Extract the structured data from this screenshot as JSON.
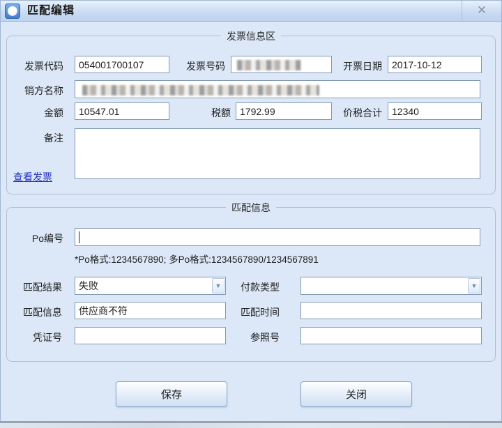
{
  "window": {
    "title": "匹配编辑",
    "close_glyph": "✕"
  },
  "invoice_section": {
    "title": "发票信息区",
    "invoice_code": {
      "label": "发票代码",
      "value": "054001700107"
    },
    "invoice_number": {
      "label": "发票号码",
      "value": ""
    },
    "invoice_date": {
      "label": "开票日期",
      "value": "2017-10-12"
    },
    "seller_name": {
      "label": "销方名称",
      "value": ""
    },
    "amount": {
      "label": "金额",
      "value": "10547.01"
    },
    "tax": {
      "label": "税额",
      "value": "1792.99"
    },
    "total": {
      "label": "价税合计",
      "value": "12340"
    },
    "remarks": {
      "label": "备注",
      "value": ""
    },
    "view_invoice_link": "查看发票"
  },
  "match_section": {
    "title": "匹配信息",
    "po_number": {
      "label": "Po编号",
      "value": ""
    },
    "po_hint": "*Po格式:1234567890; 多Po格式:1234567890/1234567891",
    "match_result": {
      "label": "匹配结果",
      "value": "失败"
    },
    "payment_type": {
      "label": "付款类型",
      "value": ""
    },
    "match_info": {
      "label": "匹配信息",
      "value": "供应商不符"
    },
    "match_time": {
      "label": "匹配时间",
      "value": ""
    },
    "voucher_no": {
      "label": "凭证号",
      "value": ""
    },
    "reference_no": {
      "label": "参照号",
      "value": ""
    }
  },
  "buttons": {
    "save": "保存",
    "close": "关闭"
  },
  "combo": {
    "arrow_glyph": "▼"
  }
}
